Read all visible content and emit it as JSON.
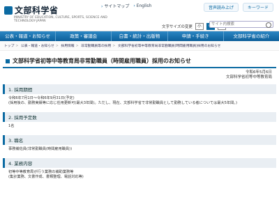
{
  "site": {
    "name": "文部科学省",
    "sub": "MINISTRY OF EDUCATION, CULTURE, SPORTS, SCIENCE AND TECHNOLOGY-JAPAN"
  },
  "utility": {
    "sitemap": "サイトマップ",
    "english": "English"
  },
  "topright": {
    "guide": "音声読み上げ",
    "keyword": "キーワード"
  },
  "access": {
    "text_size_label": "文字サイズの変更",
    "sizes": [
      "小",
      "中",
      "大"
    ]
  },
  "search": {
    "placeholder": "サイト内検索"
  },
  "nav": [
    "公表・報道・お知らせ",
    "政策・審議会",
    "白書・統計・出版物",
    "申請・手続き",
    "文部科学省の紹介"
  ],
  "breadcrumb": [
    "トップ",
    "公表・報道・お知らせ",
    "採用情報",
    "非常勤職員等の採用",
    "文部科学省初等中等教育局非常勤職員(時間雇用職員)採用のお知らせ"
  ],
  "page": {
    "title": "文部科学省初等中等教育局非常勤職員（時間雇用職員）採用のお知らせ",
    "date": "令和6年5月6日",
    "dept": "文部科学省初等中等教育局"
  },
  "sections": [
    {
      "head": "1. 採用期間",
      "lines": [
        "令和6年7月1日～令和6年9月31日(予定)",
        "(採用後の、勤務実績等に応じ任用更新可(最大3年間)。ただし、現在、文部科学省で非常勤職員として勤務している者については最大5年間。)"
      ]
    },
    {
      "head": "2. 採用予定数",
      "lines": [
        "1名"
      ]
    },
    {
      "head": "3. 職名",
      "lines": [
        "事務補佐員(非常勤職員(時間雇用職員))"
      ]
    },
    {
      "head": "4. 業務内容",
      "lines": [
        "初等中等教育局が行う業務の補助業務等",
        "(集計業務、文書作成、書類整理、電話対応等)"
      ]
    }
  ],
  "colors": {
    "accent": "#0b6aa2",
    "nav_bg": "#1f78b6"
  }
}
